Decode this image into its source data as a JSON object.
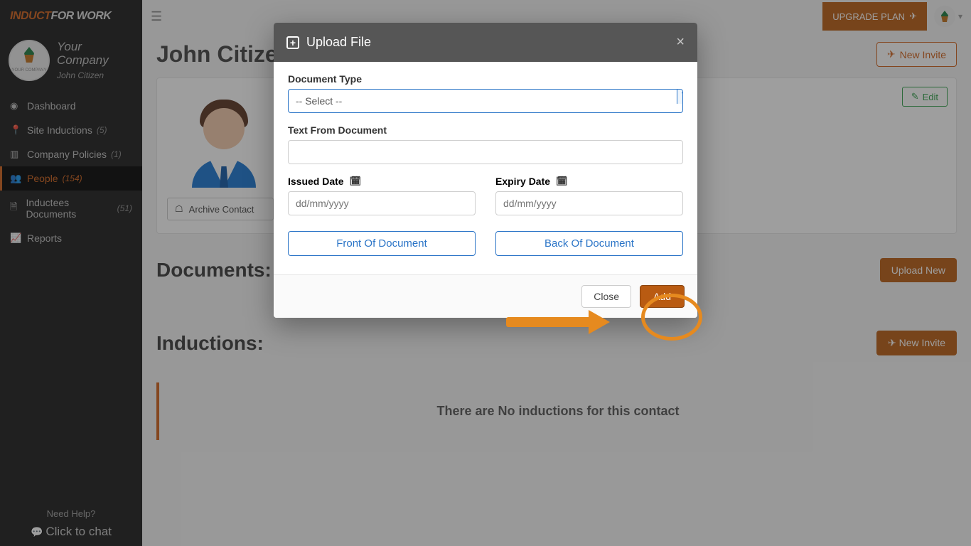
{
  "brand": {
    "part1": "INDUCT",
    "part2": "FOR WORK"
  },
  "company": {
    "name_line1": "Your",
    "name_line2": "Company",
    "user": "John Citizen",
    "logo_text": "YOUR COMPANY"
  },
  "nav": {
    "dashboard": "Dashboard",
    "site": "Site Inductions",
    "site_count": "(5)",
    "policies": "Company Policies",
    "policies_count": "(1)",
    "people": "People",
    "people_count": "(154)",
    "docs": "Inductees Documents",
    "docs_count": "(51)",
    "reports": "Reports"
  },
  "help": {
    "title": "Need Help?",
    "chat": "Click to chat"
  },
  "topbar": {
    "upgrade": "UPGRADE PLAN"
  },
  "page": {
    "title": "John Citizen",
    "new_invite": "New Invite",
    "archive": "Archive Contact",
    "edit": "Edit",
    "documents": "Documents:",
    "upload_new": "Upload New",
    "inductions": "Inductions:",
    "no_inductions": "There are No inductions for this contact"
  },
  "modal": {
    "title": "Upload File",
    "doc_type_label": "Document Type",
    "doc_type_value": "-- Select --",
    "text_label": "Text From Document",
    "issued_label": "Issued Date",
    "expiry_label": "Expiry Date",
    "date_placeholder": "dd/mm/yyyy",
    "front": "Front Of Document",
    "back": "Back Of Document",
    "close": "Close",
    "add": "Add"
  }
}
